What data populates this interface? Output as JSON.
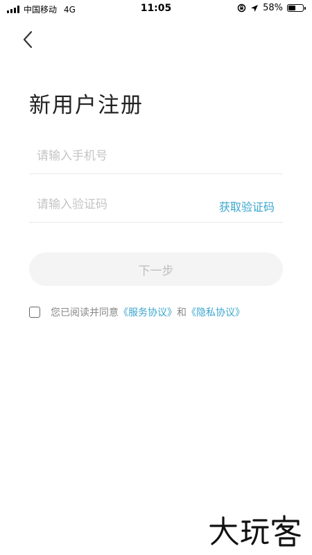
{
  "status_bar": {
    "carrier": "中国移动",
    "network": "4G",
    "time": "11:05",
    "battery_percent": "58%",
    "battery_level": 0.58
  },
  "back_icon": "chevron-left-icon",
  "page": {
    "title": "新用户注册"
  },
  "form": {
    "phone_placeholder": "请输入手机号",
    "phone_value": "",
    "code_placeholder": "请输入验证码",
    "code_value": "",
    "get_code_label": "获取验证码",
    "next_label": "下一步"
  },
  "agreement": {
    "checked": false,
    "prefix": "您已阅读并同意",
    "service_link": "《服务协议》",
    "conjunction": "和",
    "privacy_link": "《隐私协议》"
  },
  "watermark": "大玩客",
  "colors": {
    "accent": "#3aa6cf",
    "button_bg": "#f4f4f4",
    "button_text": "#bdbdbd",
    "placeholder": "#c4c4c4"
  }
}
